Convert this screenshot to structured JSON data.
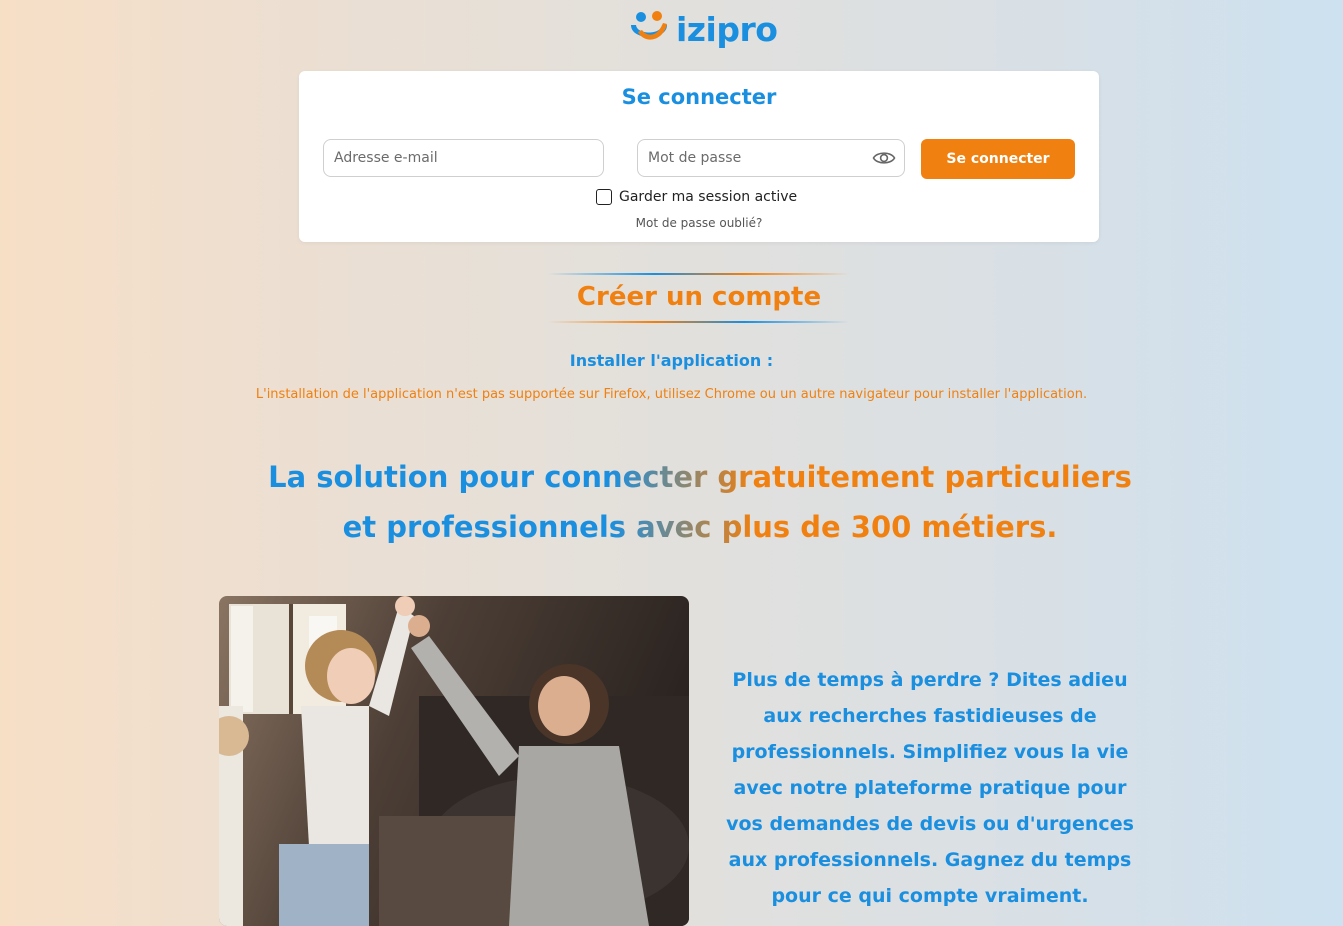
{
  "brand": {
    "name": "izipro",
    "logo_icon": "people-hug-logo",
    "colors": {
      "blue": "#1a8fe0",
      "orange": "#f08010"
    }
  },
  "login": {
    "title": "Se connecter",
    "email_placeholder": "Adresse e-mail",
    "password_placeholder": "Mot de passe",
    "submit_label": "Se connecter",
    "remember_label": "Garder ma session active",
    "forgot_label": "Mot de passe oublié?",
    "show_password_icon": "eye-icon"
  },
  "create_account": {
    "label": "Créer un compte"
  },
  "install": {
    "title": "Installer l'application :",
    "message": "L'installation de l'application n'est pas supportée sur Firefox, utilisez Chrome ou un autre navigateur pour installer l'application."
  },
  "headline": "La solution pour connecter gratuitement particuliers et professionnels avec plus de 300 métiers.",
  "feature": {
    "image": "mother-and-child-high-five-photo",
    "text": "Plus de temps à perdre ? Dites adieu aux recherches fastidieuses de professionnels. Simplifiez vous la vie avec notre plateforme pratique pour vos demandes de devis ou d'urgences aux professionnels. Gagnez du temps pour ce qui compte vraiment."
  }
}
